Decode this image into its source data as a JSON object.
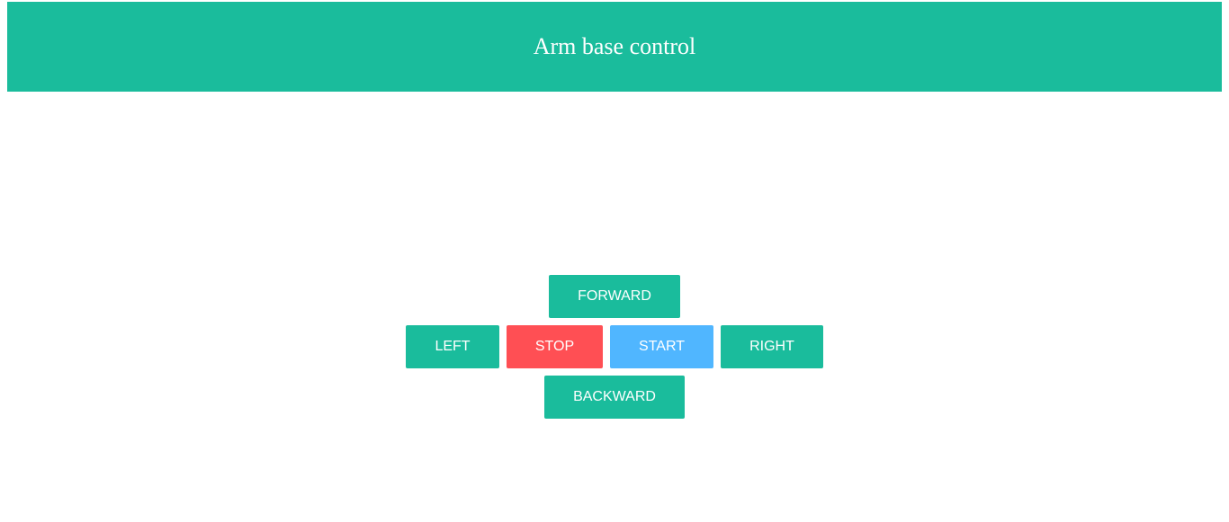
{
  "header": {
    "title": "Arm base control"
  },
  "controls": {
    "forward_label": "FORWARD",
    "left_label": "LEFT",
    "stop_label": "STOP",
    "start_label": "START",
    "right_label": "RIGHT",
    "backward_label": "BACKWARD"
  },
  "colors": {
    "primary": "#1abc9c",
    "stop": "#ff4f54",
    "start": "#50b6ff",
    "text_on_button": "#ffffff"
  }
}
